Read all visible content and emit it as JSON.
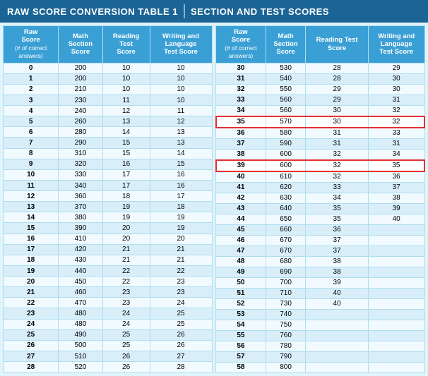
{
  "header": {
    "left": "RAW SCORE CONVERSION TABLE 1",
    "right": "SECTION AND TEST SCORES"
  },
  "table1": {
    "columns": [
      "Raw Score\n(# of correct answers)",
      "Math Section Score",
      "Reading Test Score",
      "Writing and Language Test Score"
    ],
    "rows": [
      [
        0,
        200,
        10,
        10
      ],
      [
        1,
        200,
        10,
        10
      ],
      [
        2,
        210,
        10,
        10
      ],
      [
        3,
        230,
        11,
        10
      ],
      [
        4,
        240,
        12,
        11
      ],
      [
        5,
        260,
        13,
        12
      ],
      [
        6,
        280,
        14,
        13
      ],
      [
        7,
        290,
        15,
        13
      ],
      [
        8,
        310,
        15,
        14
      ],
      [
        9,
        320,
        16,
        15
      ],
      [
        10,
        330,
        17,
        16
      ],
      [
        11,
        340,
        17,
        16
      ],
      [
        12,
        360,
        18,
        17
      ],
      [
        13,
        370,
        19,
        18
      ],
      [
        14,
        380,
        19,
        19
      ],
      [
        15,
        390,
        20,
        19
      ],
      [
        16,
        410,
        20,
        20
      ],
      [
        17,
        420,
        21,
        21
      ],
      [
        18,
        430,
        21,
        21
      ],
      [
        19,
        440,
        22,
        22
      ],
      [
        20,
        450,
        22,
        23
      ],
      [
        21,
        460,
        23,
        23
      ],
      [
        22,
        470,
        23,
        24
      ],
      [
        23,
        480,
        24,
        25
      ],
      [
        24,
        480,
        24,
        25
      ],
      [
        25,
        490,
        25,
        26
      ],
      [
        26,
        500,
        25,
        26
      ],
      [
        27,
        510,
        26,
        27
      ],
      [
        28,
        520,
        26,
        28
      ]
    ]
  },
  "table2": {
    "columns": [
      "Raw Score\n(# of correct answers)",
      "Math Section Score",
      "Reading Test Score",
      "Writing and Language Test Score"
    ],
    "rows": [
      [
        30,
        530,
        28,
        29
      ],
      [
        31,
        540,
        28,
        30
      ],
      [
        32,
        550,
        29,
        30
      ],
      [
        33,
        560,
        29,
        31
      ],
      [
        34,
        560,
        30,
        32
      ],
      [
        35,
        570,
        30,
        32
      ],
      [
        36,
        580,
        31,
        33
      ],
      [
        37,
        590,
        31,
        31
      ],
      [
        38,
        600,
        32,
        34
      ],
      [
        39,
        600,
        32,
        35
      ],
      [
        40,
        610,
        32,
        36
      ],
      [
        41,
        620,
        33,
        37
      ],
      [
        42,
        630,
        34,
        38
      ],
      [
        43,
        640,
        35,
        39
      ],
      [
        44,
        650,
        35,
        40
      ],
      [
        45,
        660,
        36,
        ""
      ],
      [
        46,
        670,
        37,
        ""
      ],
      [
        47,
        670,
        37,
        ""
      ],
      [
        48,
        680,
        38,
        ""
      ],
      [
        49,
        690,
        38,
        ""
      ],
      [
        50,
        700,
        39,
        ""
      ],
      [
        51,
        710,
        40,
        ""
      ],
      [
        52,
        730,
        40,
        ""
      ],
      [
        53,
        740,
        "",
        ""
      ],
      [
        54,
        750,
        "",
        ""
      ],
      [
        55,
        760,
        "",
        ""
      ],
      [
        56,
        780,
        "",
        ""
      ],
      [
        57,
        790,
        "",
        ""
      ],
      [
        58,
        800,
        "",
        ""
      ]
    ],
    "highlight_rows": [
      35,
      39
    ]
  }
}
